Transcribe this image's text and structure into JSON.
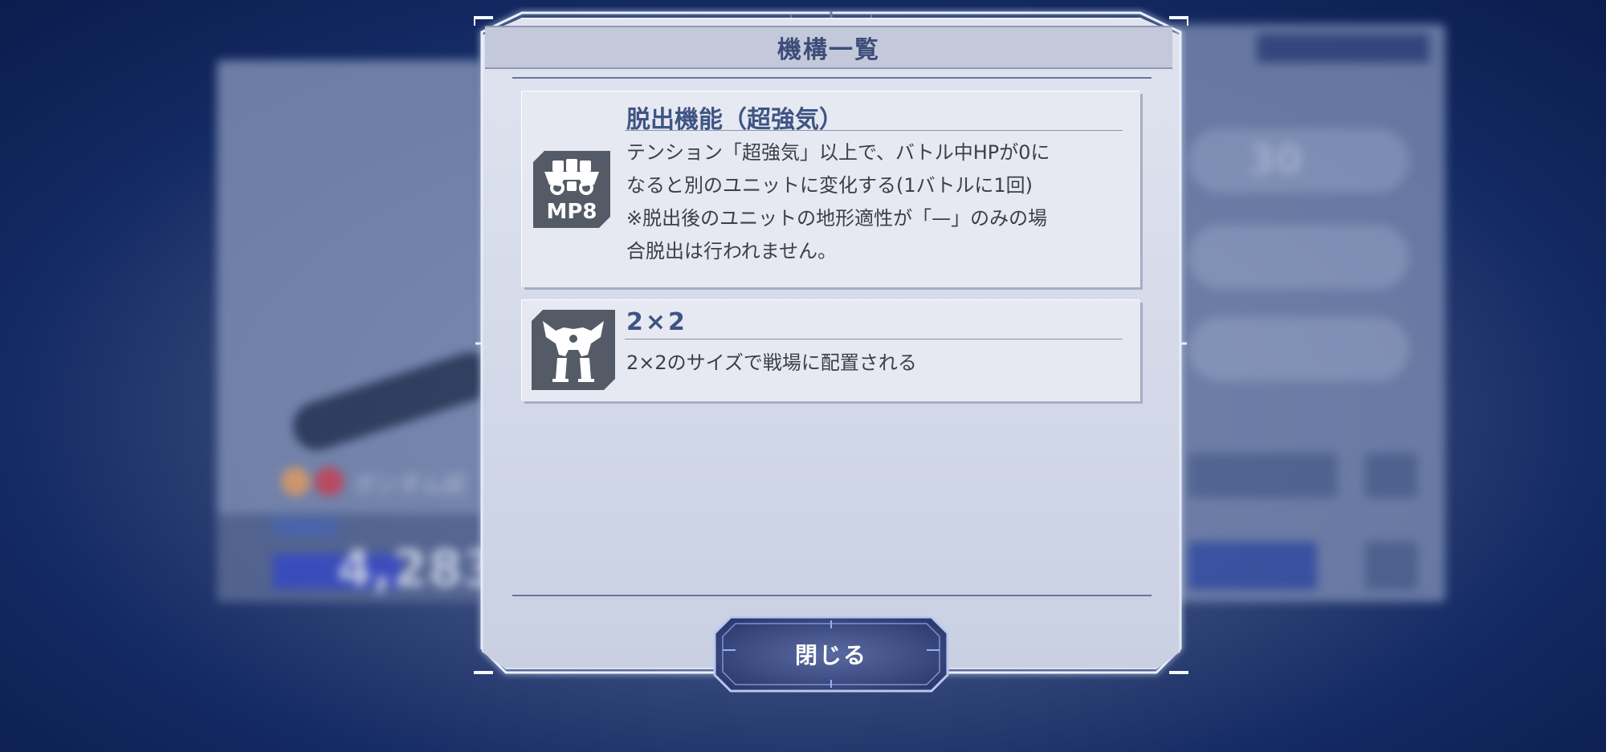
{
  "background": {
    "unit_name": "ガンダム試",
    "power_value": "4,283",
    "level_value": "30"
  },
  "dialog": {
    "title": "機構一覧",
    "items": [
      {
        "icon": "mp8-unit-icon",
        "icon_label": "MP8",
        "title": "脱出機能（超強気）",
        "description": "テンション「超強気」以上で、バトル中HPが0に\nなると別のユニットに変化する(1バトルに1回)\n※脱出後のユニットの地形適性が「—」のみの場\n合脱出は行われません。"
      },
      {
        "icon": "mech-silhouette-icon",
        "title": "2×2",
        "description": "2×2のサイズで戦場に配置される"
      }
    ],
    "close_label": "閉じる"
  },
  "colors": {
    "title_text": "#3d4d78",
    "item_title": "#3f5484",
    "body_text": "#3b3f4a",
    "button_bg": "#2c3a70",
    "background_navy": "#0b1c4d"
  }
}
